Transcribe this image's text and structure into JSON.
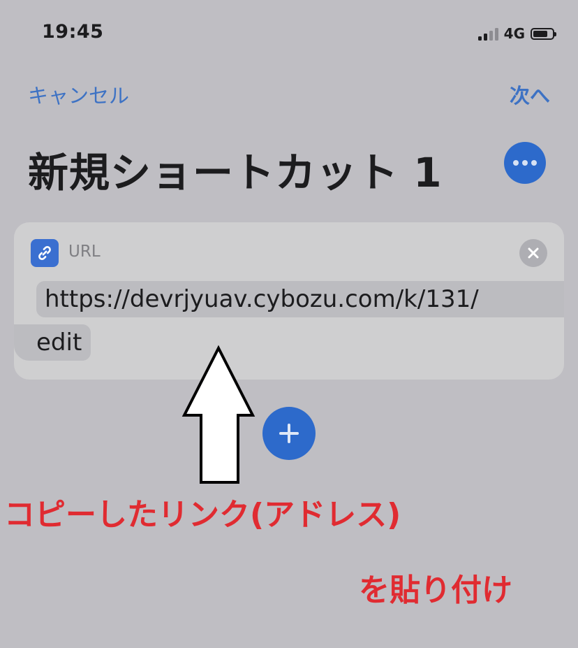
{
  "status_bar": {
    "time": "19:45",
    "network": "4G",
    "signal_icon": "cellular-signal-icon",
    "battery_icon": "battery-icon"
  },
  "nav": {
    "cancel_label": "キャンセル",
    "next_label": "次へ"
  },
  "header": {
    "title": "新規ショートカット 1",
    "more_icon": "ellipsis-icon"
  },
  "url_action": {
    "icon": "link-icon",
    "label": "URL",
    "value_line1": "https://devrjyuav.cybozu.com/k/131/",
    "value_line2": "edit",
    "clear_icon": "clear-x-icon"
  },
  "add_action": {
    "icon": "plus-icon"
  },
  "annotation": {
    "arrow_icon": "up-arrow-icon",
    "line1": "コピーしたリンク(アドレス)",
    "line2": "を貼り付け"
  },
  "colors": {
    "background": "#bfbec3",
    "accent": "#2d6acb",
    "link_text": "#3d72c4",
    "annotation_red": "#e02b31"
  }
}
